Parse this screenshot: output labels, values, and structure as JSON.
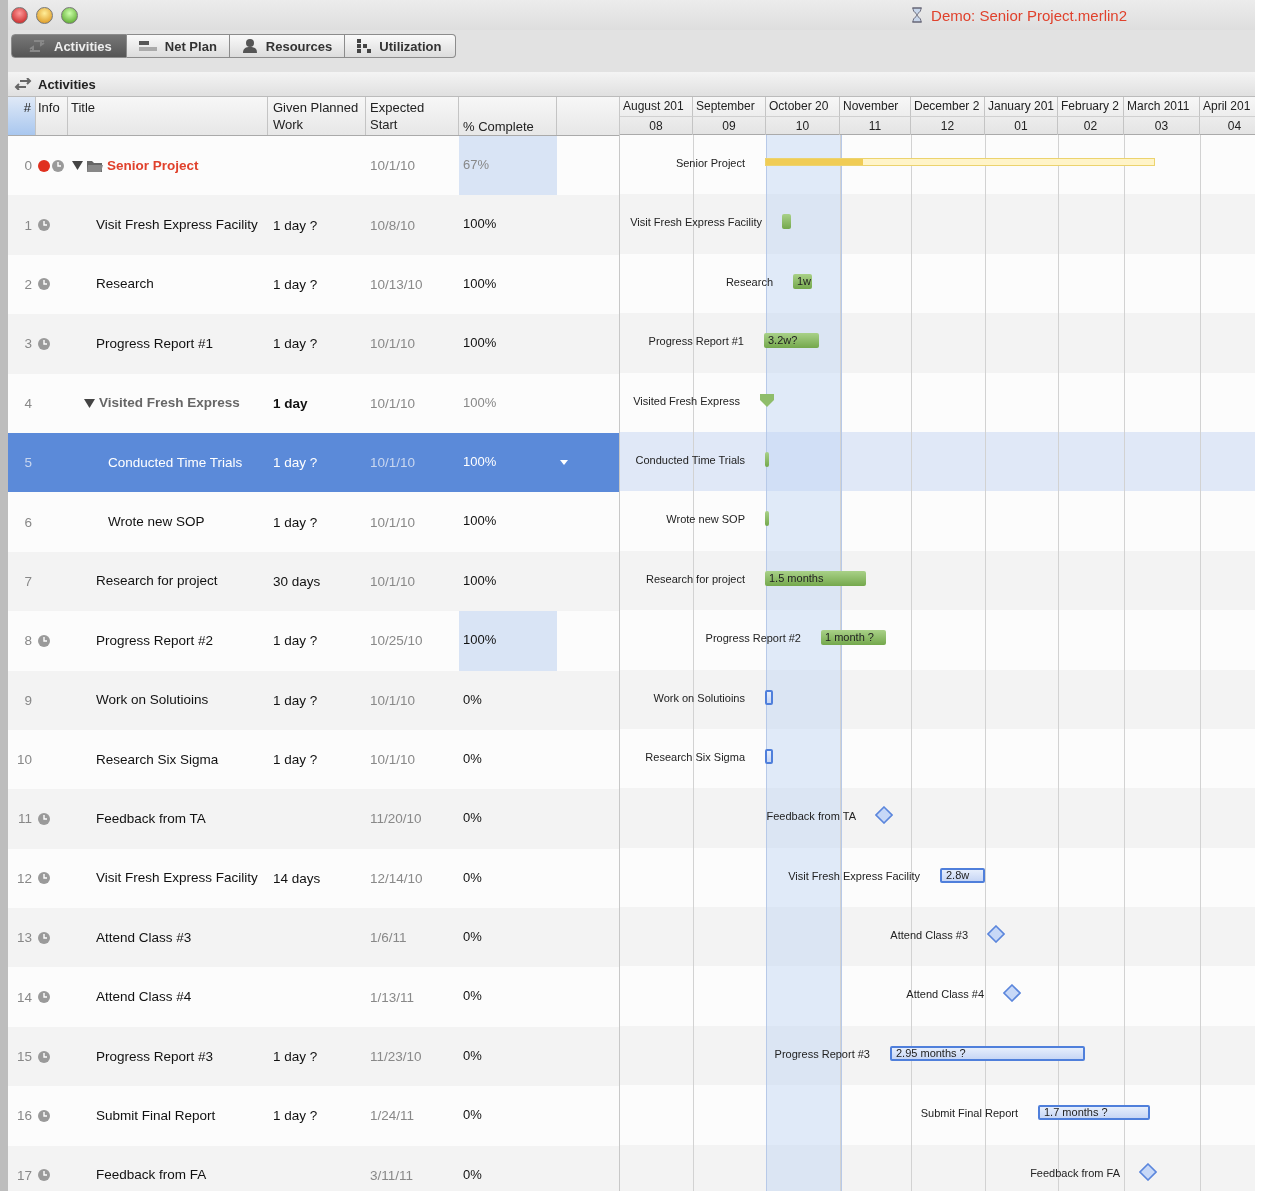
{
  "window": {
    "title": "Demo: Senior Project.merlin2"
  },
  "tabs": [
    {
      "label": "Activities",
      "selected": true
    },
    {
      "label": "Net Plan",
      "selected": false
    },
    {
      "label": "Resources",
      "selected": false
    },
    {
      "label": "Utilization",
      "selected": false
    }
  ],
  "panel": {
    "title": "Activities"
  },
  "table": {
    "columns": [
      {
        "label": "#"
      },
      {
        "label": "Info"
      },
      {
        "label": "Title"
      },
      {
        "label": "Given Planned Work"
      },
      {
        "label": "Expected Start"
      },
      {
        "label": "% Complete"
      }
    ],
    "months": [
      {
        "label": "August 201",
        "number": "08",
        "current": false
      },
      {
        "label": "September",
        "number": "09",
        "current": false
      },
      {
        "label": "October 20",
        "number": "10",
        "current": true
      },
      {
        "label": "November",
        "number": "11",
        "current": false
      },
      {
        "label": "December 2",
        "number": "12",
        "current": false
      },
      {
        "label": "January 201",
        "number": "01",
        "current": false
      },
      {
        "label": "February 2",
        "number": "02",
        "current": false
      },
      {
        "label": "March 2011",
        "number": "03",
        "current": false
      },
      {
        "label": "April 201",
        "number": "04",
        "current": false
      }
    ],
    "rows": [
      {
        "number": "0",
        "kind": "project",
        "alert": true,
        "clock": true,
        "title": "Senior Project",
        "start": "10/1/10",
        "complete": "67%",
        "highlighted": true,
        "selected": false,
        "expanded": true,
        "gantt": {
          "kind": "summary",
          "label": "Senior Project",
          "level": 0.25
        },
        "children": [
          {
            "number": "1",
            "kind": "task",
            "alert": false,
            "clock": true,
            "title": "Visit Fresh Express Facility",
            "work": "1 day ?",
            "start": "10/8/10",
            "complete": "100%",
            "highlighted": false,
            "selected": false,
            "gantt": {
              "kind": "done",
              "label": "Visit Fresh Express Facility"
            }
          },
          {
            "number": "2",
            "kind": "task",
            "alert": false,
            "clock": true,
            "title": "Research",
            "work": "1 day ?",
            "start": "10/13/10",
            "complete": "100%",
            "highlighted": false,
            "selected": false,
            "gantt": {
              "kind": "done",
              "label": "Research",
              "text": "1w"
            }
          },
          {
            "number": "3",
            "kind": "task",
            "alert": false,
            "clock": true,
            "title": "Progress Report #1",
            "work": "1 day ?",
            "start": "10/1/10",
            "complete": "100%",
            "highlighted": false,
            "selected": false,
            "gantt": {
              "kind": "done",
              "label": "Progress Report #1",
              "text": "3.2w?"
            }
          },
          {
            "number": "4",
            "kind": "group",
            "alert": false,
            "clock": false,
            "title": "Visited Fresh Express",
            "work": "1 day",
            "start": "10/1/10",
            "complete": "100%",
            "highlighted": false,
            "selected": false,
            "expanded": true,
            "gantt": {
              "kind": "group",
              "label": "Visited Fresh Express"
            },
            "children": [
              {
                "number": "5",
                "kind": "task",
                "alert": false,
                "clock": false,
                "title": "Conducted Time Trials",
                "work": "1 day ?",
                "start": "10/1/10",
                "complete": "100%",
                "highlighted": false,
                "selected": true,
                "gantt": {
                  "kind": "done",
                  "label": "Conducted Time Trials"
                }
              },
              {
                "number": "6",
                "kind": "task",
                "alert": false,
                "clock": false,
                "title": "Wrote new SOP",
                "work": "1 day ?",
                "start": "10/1/10",
                "complete": "100%",
                "highlighted": false,
                "selected": false,
                "gantt": {
                  "kind": "done",
                  "label": "Wrote new SOP"
                }
              }
            ]
          },
          {
            "number": "7",
            "kind": "task",
            "alert": false,
            "clock": false,
            "title": "Research for project",
            "work": "30 days",
            "start": "10/1/10",
            "complete": "100%",
            "highlighted": false,
            "selected": false,
            "gantt": {
              "kind": "done",
              "label": "Research for project",
              "text": "1.5 months"
            }
          },
          {
            "number": "8",
            "kind": "task",
            "alert": false,
            "clock": true,
            "title": "Progress Report #2",
            "work": "1 day ?",
            "start": "10/25/10",
            "complete": "100%",
            "highlighted": true,
            "selected": false,
            "gantt": {
              "kind": "done",
              "label": "Progress Report #2",
              "text": "1 month ?"
            }
          },
          {
            "number": "9",
            "kind": "task",
            "alert": false,
            "clock": false,
            "title": "Work on Solutioins",
            "work": "1 day ?",
            "start": "10/1/10",
            "complete": "0%",
            "highlighted": false,
            "selected": false,
            "gantt": {
              "kind": "open",
              "label": "Work on Solutioins"
            }
          },
          {
            "number": "10",
            "kind": "task",
            "alert": false,
            "clock": false,
            "title": "Research Six Sigma",
            "work": "1 day ?",
            "start": "10/1/10",
            "complete": "0%",
            "highlighted": false,
            "selected": false,
            "gantt": {
              "kind": "open",
              "label": "Research Six Sigma"
            }
          },
          {
            "number": "11",
            "kind": "task",
            "alert": false,
            "clock": true,
            "title": "Feedback from TA",
            "start": "11/20/10",
            "complete": "0%",
            "highlighted": false,
            "selected": false,
            "gantt": {
              "kind": "milestone",
              "label": "Feedback from TA"
            }
          },
          {
            "number": "12",
            "kind": "task",
            "alert": false,
            "clock": true,
            "title": "Visit Fresh Express Facility",
            "work": "14 days",
            "start": "12/14/10",
            "complete": "0%",
            "highlighted": false,
            "selected": false,
            "gantt": {
              "kind": "open",
              "label": "Visit Fresh Express Facility",
              "text": "2.8w"
            }
          },
          {
            "number": "13",
            "kind": "task",
            "alert": false,
            "clock": true,
            "title": "Attend Class #3",
            "start": "1/6/11",
            "complete": "0%",
            "highlighted": false,
            "selected": false,
            "gantt": {
              "kind": "milestone",
              "label": "Attend Class #3"
            }
          },
          {
            "number": "14",
            "kind": "task",
            "alert": false,
            "clock": true,
            "title": "Attend Class #4",
            "start": "1/13/11",
            "complete": "0%",
            "highlighted": false,
            "selected": false,
            "gantt": {
              "kind": "milestone",
              "label": "Attend Class #4"
            }
          },
          {
            "number": "15",
            "kind": "task",
            "alert": false,
            "clock": true,
            "title": "Progress Report #3",
            "work": "1 day ?",
            "start": "11/23/10",
            "complete": "0%",
            "highlighted": false,
            "selected": false,
            "gantt": {
              "kind": "open",
              "label": "Progress Report #3",
              "text": "2.95 months ?"
            }
          },
          {
            "number": "16",
            "kind": "task",
            "alert": false,
            "clock": true,
            "title": "Submit Final Report",
            "work": "1 day ?",
            "start": "1/24/11",
            "complete": "0%",
            "highlighted": false,
            "selected": false,
            "gantt": {
              "kind": "open",
              "label": "Submit Final Report",
              "text": "1.7 months ?"
            }
          },
          {
            "number": "17",
            "kind": "task",
            "alert": false,
            "clock": true,
            "title": "Feedback from FA",
            "start": "3/11/11",
            "complete": "0%",
            "highlighted": false,
            "selected": false,
            "gantt": {
              "kind": "milestone",
              "label": "Feedback from FA"
            }
          }
        ]
      }
    ]
  }
}
